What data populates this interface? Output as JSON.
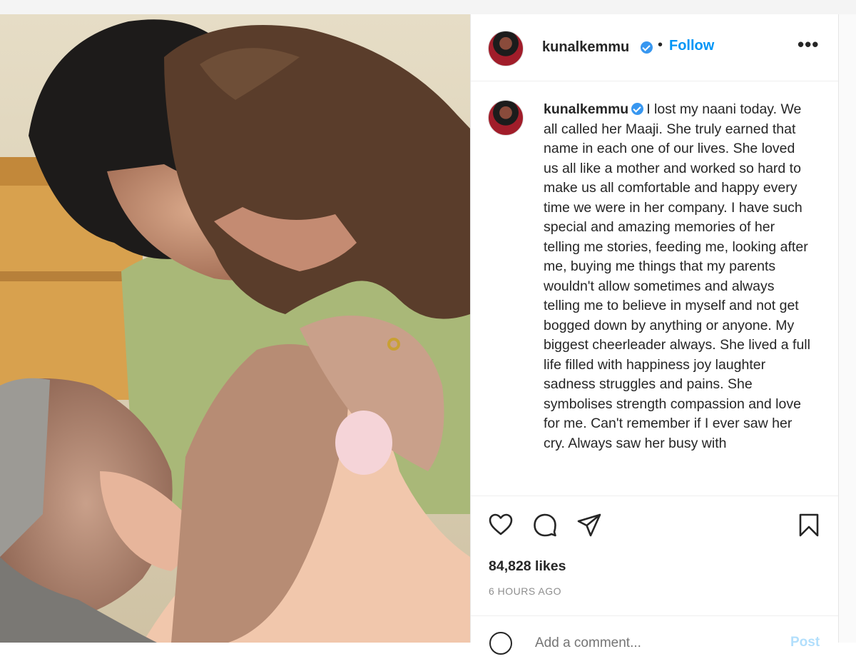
{
  "post": {
    "image_alt": "Kunal Kemmu and his daughter with his grandmother"
  },
  "header": {
    "username": "kunalkemmu",
    "separator": "•",
    "follow_label": "Follow",
    "more_icon": "more-options-icon",
    "more_label": "•••"
  },
  "caption": {
    "username": "kunalkemmu",
    "text": "I lost my naani today. We all called her Maaji. She truly earned that name in each one of our lives. She loved us all like a mother and worked so hard to make us all comfortable and happy every time we were in her company. I have such special and amazing memories of her telling me stories, feeding me, looking after me, buying me things that my parents wouldn't allow sometimes and always telling me to believe in myself and not get bogged down by anything or anyone. My biggest cheerleader always. She lived a full life filled with happiness joy laughter sadness struggles and pains. She symbolises strength compassion and love for me. Can't remember if I ever saw her cry. Always saw her busy with"
  },
  "actions": {
    "like_icon": "heart-icon",
    "comment_icon": "comment-icon",
    "share_icon": "share-icon",
    "save_icon": "bookmark-icon"
  },
  "stats": {
    "likes": "84,828 likes",
    "timestamp": "6 HOURS AGO"
  },
  "comment_box": {
    "placeholder": "Add a comment...",
    "post_label": "Post"
  },
  "colors": {
    "accent": "#0095f6",
    "verified": "#3897f0",
    "muted": "#8e8e8e"
  }
}
